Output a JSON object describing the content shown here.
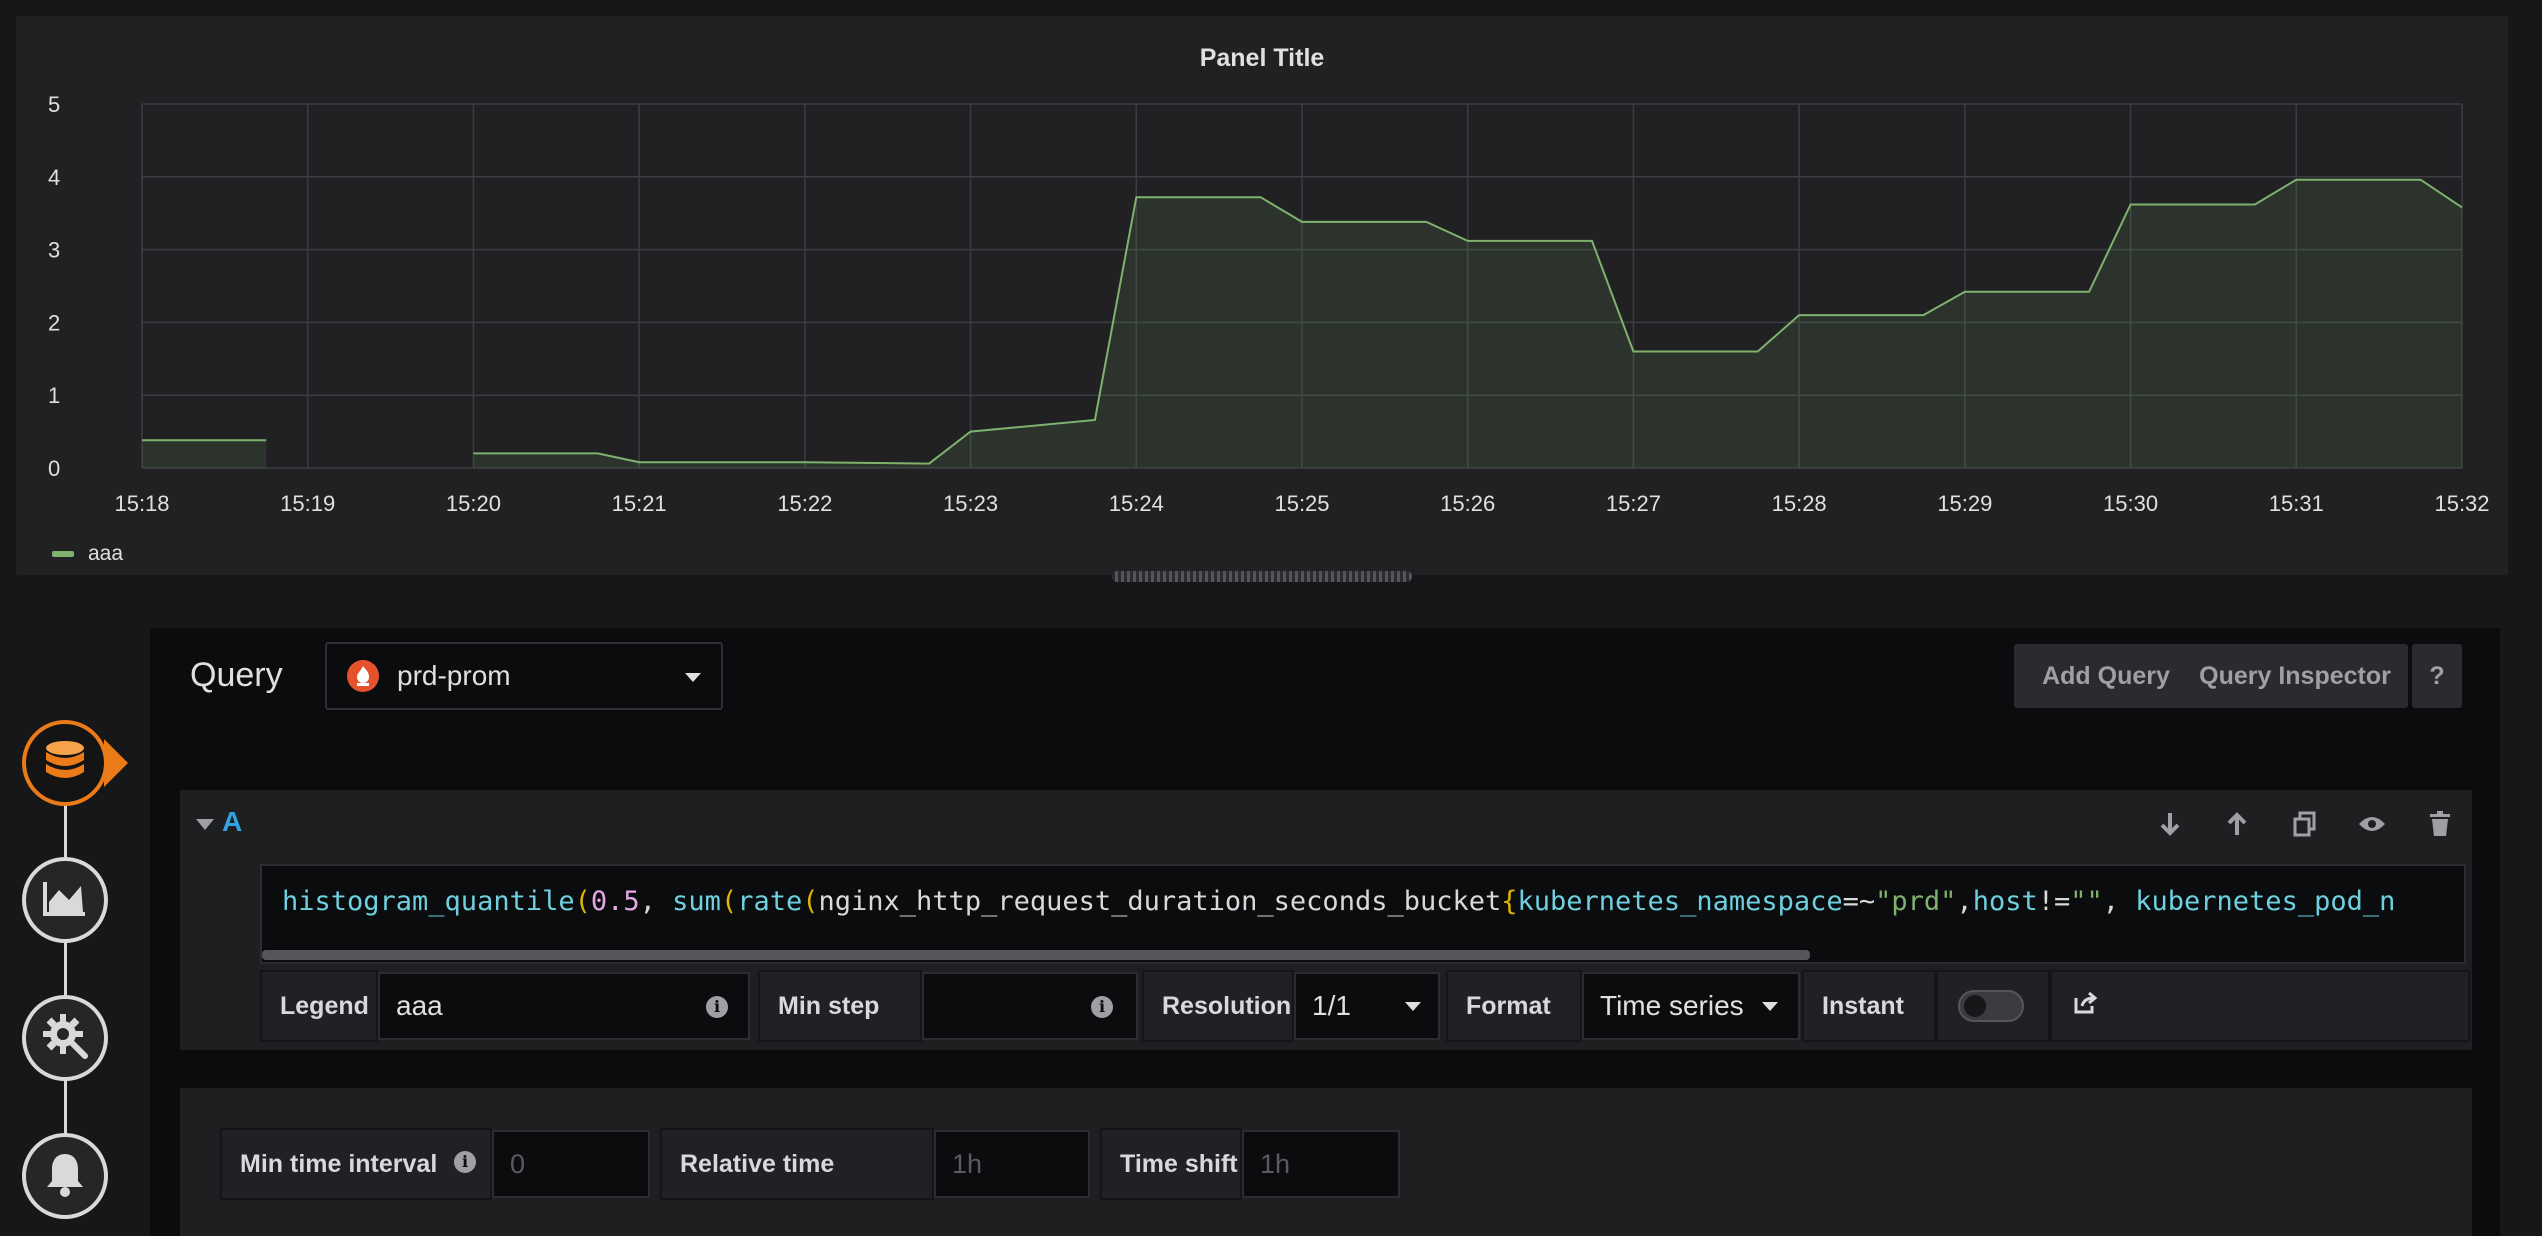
{
  "panel": {
    "title": "Panel Title",
    "legend_label": "aaa"
  },
  "chart_data": {
    "type": "area",
    "title": "Panel Title",
    "series": [
      {
        "name": "aaa",
        "color": "#7eb26d",
        "segments": [
          [
            [
              "15:18",
              0.38
            ],
            [
              "15:18:45",
              0.38
            ]
          ],
          [
            [
              "15:20",
              0.2
            ],
            [
              "15:20:45",
              0.2
            ],
            [
              "15:20:45",
              0.2
            ],
            [
              "15:21",
              0.08
            ],
            [
              "15:22",
              0.08
            ],
            [
              "15:22:45",
              0.06
            ],
            [
              "15:23",
              0.5
            ],
            [
              "15:23:45",
              0.66
            ],
            [
              "15:23:45",
              0.66
            ],
            [
              "15:24",
              3.72
            ],
            [
              "15:24:45",
              3.72
            ],
            [
              "15:25",
              3.38
            ],
            [
              "15:25:45",
              3.38
            ],
            [
              "15:26",
              3.12
            ],
            [
              "15:26:45",
              3.12
            ],
            [
              "15:27",
              1.6
            ],
            [
              "15:27:45",
              1.6
            ],
            [
              "15:28",
              2.1
            ],
            [
              "15:28:45",
              2.1
            ],
            [
              "15:29",
              2.42
            ],
            [
              "15:29:45",
              2.42
            ],
            [
              "15:30",
              3.62
            ],
            [
              "15:30:45",
              3.62
            ],
            [
              "15:31",
              3.96
            ],
            [
              "15:31:45",
              3.96
            ],
            [
              "15:32",
              3.58
            ]
          ]
        ]
      }
    ],
    "x_ticks": [
      "15:18",
      "15:19",
      "15:20",
      "15:21",
      "15:22",
      "15:23",
      "15:24",
      "15:25",
      "15:26",
      "15:27",
      "15:28",
      "15:29",
      "15:30",
      "15:31",
      "15:32"
    ],
    "y_ticks": [
      "0",
      "1",
      "2",
      "3",
      "4",
      "5"
    ],
    "ylim": [
      0,
      5
    ],
    "xlim": [
      "15:18",
      "15:32"
    ],
    "grid": true,
    "legend_position": "bottom-left"
  },
  "sidebar": {
    "items": [
      {
        "icon": "database-icon",
        "active": true
      },
      {
        "icon": "chart-area-icon",
        "active": false
      },
      {
        "icon": "gear-icon",
        "active": false
      },
      {
        "icon": "bell-icon",
        "active": false
      }
    ]
  },
  "query": {
    "title": "Query",
    "datasource": "prd-prom",
    "add_query_label": "Add Query",
    "inspector_label": "Query Inspector",
    "help_label": "?",
    "row_label": "A",
    "expr_parts": {
      "fn1": "histogram_quantile",
      "p1": "(",
      "num": "0.5",
      "sep1": ", ",
      "fn2": "sum",
      "p2": "(",
      "fn3": "rate",
      "p3": "(",
      "metric": "nginx_http_request_duration_seconds_bucket",
      "b1": "{",
      "l1": "kubernetes_namespace",
      "op1": "=~",
      "v1": "\"prd\"",
      "sep2": ",",
      "l2": "host",
      "op2": "!=",
      "v2": "\"\"",
      "sep3": ", ",
      "l3": "kubernetes_pod_n"
    },
    "options": {
      "legend_label": "Legend",
      "legend_value": "aaa",
      "min_step_label": "Min step",
      "min_step_value": "",
      "resolution_label": "Resolution",
      "resolution_value": "1/1",
      "format_label": "Format",
      "format_value": "Time series",
      "instant_label": "Instant",
      "instant_on": false
    }
  },
  "query_options": {
    "min_interval_label": "Min time interval",
    "min_interval_placeholder": "0",
    "relative_time_label": "Relative time",
    "relative_time_placeholder": "1h",
    "time_shift_label": "Time shift",
    "time_shift_placeholder": "1h"
  }
}
